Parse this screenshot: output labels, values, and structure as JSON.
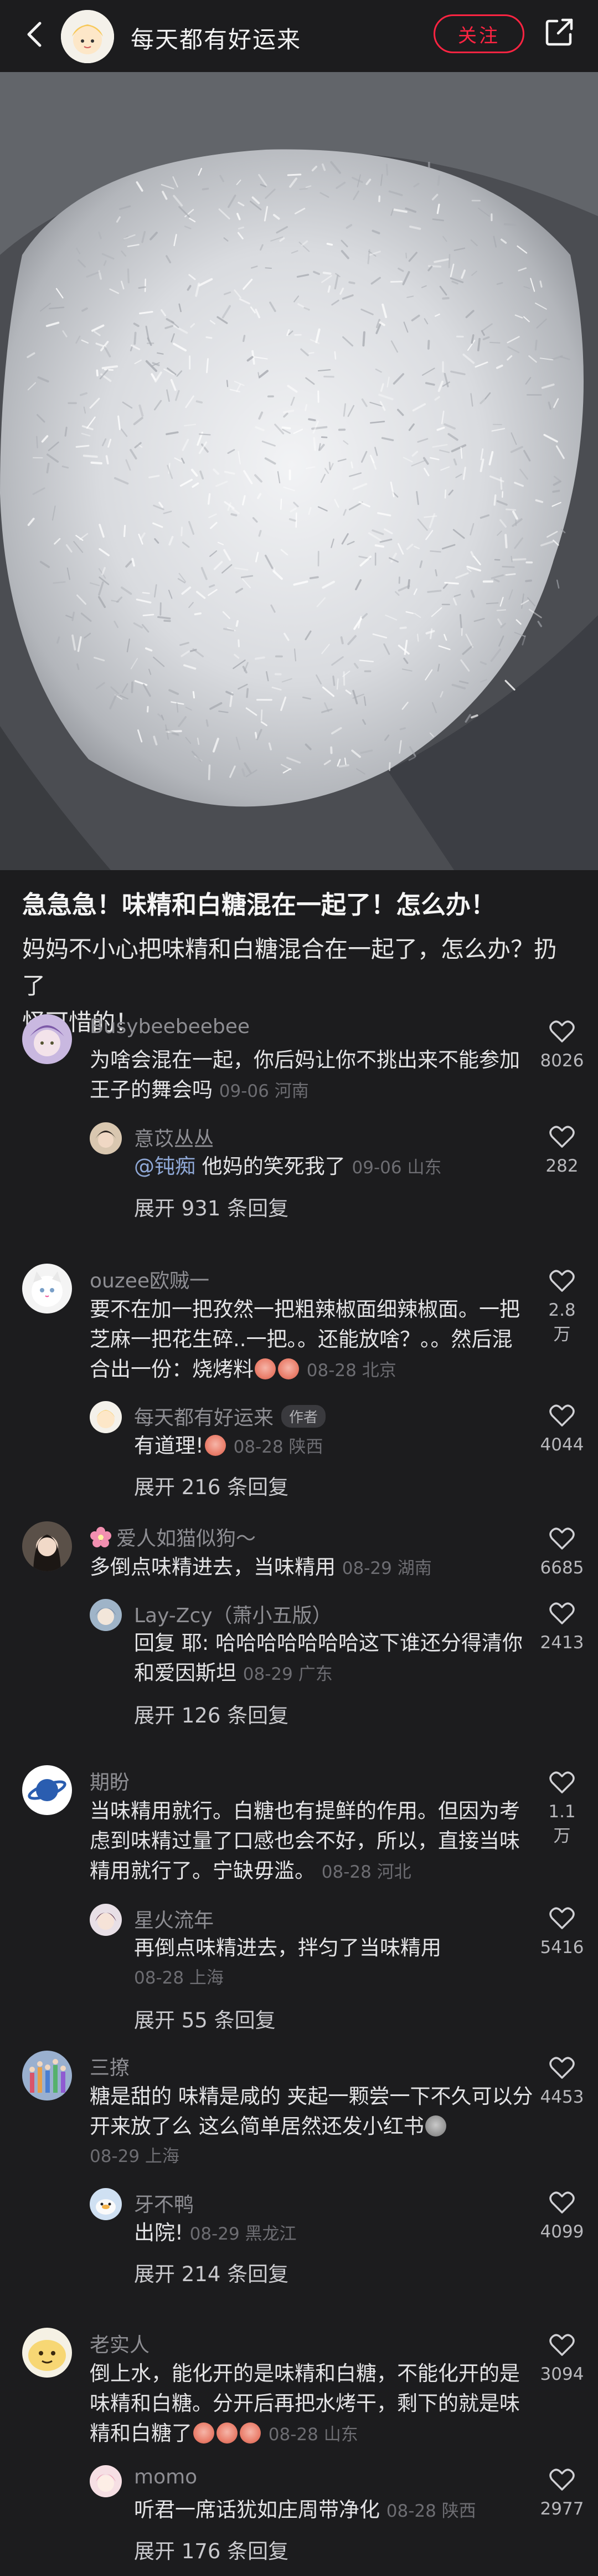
{
  "header": {
    "author_name": "每天都有好运来",
    "follow_label": "关注",
    "icons": {
      "back": "back-chevron-icon",
      "share": "share-icon"
    }
  },
  "post": {
    "title": "急急急！味精和白糖混在一起了！怎么办！",
    "body_line1": "妈妈不小心把味精和白糖混合在一起了，怎么办？扔了",
    "body_line2": "怪可惜的！"
  },
  "comments": [
    {
      "user": "Busybeebeebee",
      "line1": "为啥会混在一起，你后妈让你不挑出来不能参加",
      "line2": "王子的舞会吗",
      "meta": "09-06 河南",
      "likes": "8026",
      "reply": {
        "user": "意苡丛丛",
        "mention": "@钝痴",
        "text": " 他妈的笑死我了",
        "meta": "09-06 山东",
        "likes": "282"
      },
      "expand": "展开 931 条回复"
    },
    {
      "user": "ouzee欧贼一",
      "line1": "要不在加一把孜然一把粗辣椒面细辣椒面。一把",
      "line2": "芝麻一把花生碎..一把。。还能放啥？。。然后混",
      "line3": "合出一份：烧烤料",
      "meta": "08-28 北京",
      "likes": "2.8万",
      "reply": {
        "user": "每天都有好运来",
        "badge": "作者",
        "text": "有道理!",
        "meta": "08-28 陕西",
        "likes": "4044"
      },
      "expand": "展开 216 条回复"
    },
    {
      "user": "爱人如猫似狗～",
      "line1": "多倒点味精进去，当味精用",
      "meta": "08-29 湖南",
      "likes": "6685",
      "reply": {
        "user": "Lay-Zcy（萧小五版）",
        "line1": "回复 耶: 哈哈哈哈哈哈哈这下谁还分得清你",
        "line2": "和爱因斯坦",
        "meta": "08-29 广东",
        "likes": "2413"
      },
      "expand": "展开 126 条回复"
    },
    {
      "user": "期盼",
      "line1": "当味精用就行。白糖也有提鲜的作用。但因为考",
      "line2": "虑到味精过量了口感也会不好，所以，直接当味",
      "line3": "精用就行了。宁缺毋滥。",
      "meta": "08-28 河北",
      "likes": "1.1万",
      "reply": {
        "user": "星火流年",
        "text": "再倒点味精进去，拌匀了当味精用",
        "meta": "08-28 上海",
        "likes": "5416"
      },
      "expand": "展开 55 条回复"
    },
    {
      "user": "三撩",
      "line1": "糖是甜的 味精是咸的 夹起一颗尝一下不久可以分",
      "line2": "开来放了么 这么简单居然还发小红书",
      "meta": "08-29 上海",
      "likes": "4453",
      "reply": {
        "user": "牙不鸭",
        "text": "出院!",
        "meta": "08-29 黑龙江",
        "likes": "4099"
      },
      "expand": "展开 214 条回复"
    },
    {
      "user": "老实人",
      "line1": "倒上水，能化开的是味精和白糖，不能化开的是",
      "line2": "味精和白糖。分开后再把水烤干，剩下的就是味",
      "line3": "精和白糖了",
      "meta": "08-28 山东",
      "likes": "3094",
      "reply": {
        "user": "momo",
        "text": "听君一席话犹如庄周带净化",
        "meta": "08-28 陕西",
        "likes": "2977"
      },
      "expand": "展开 176 条回复"
    }
  ]
}
